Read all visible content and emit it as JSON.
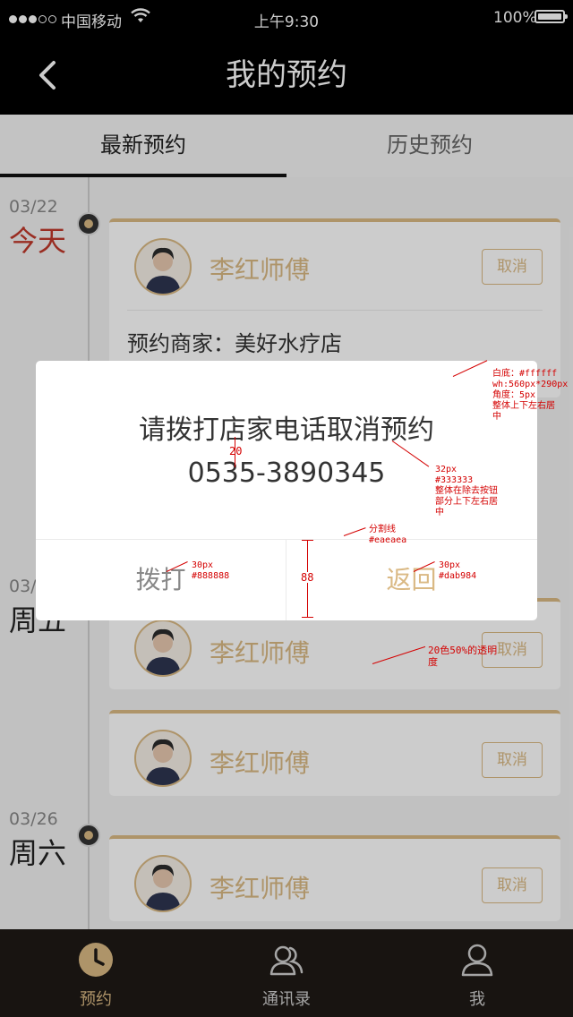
{
  "status_bar": {
    "carrier": "中国移动",
    "time": "上午9:30",
    "battery": "100%"
  },
  "nav": {
    "title": "我的预约",
    "back_icon": "back-arrow-icon"
  },
  "tabs": [
    {
      "label": "最新预约",
      "active": true
    },
    {
      "label": "历史预约",
      "active": false
    }
  ],
  "groups": [
    {
      "date": "03/22",
      "weekday": "今天",
      "today": true
    },
    {
      "date": "03/",
      "weekday": "周五",
      "today": false
    },
    {
      "date": "03/26",
      "weekday": "周六",
      "today": false
    }
  ],
  "cards": [
    {
      "master": "李红师傅",
      "cancel": "取消",
      "merchant_label": "预约商家：",
      "merchant": "美好水疗店"
    },
    {
      "master": "李红师傅",
      "cancel": "取消"
    },
    {
      "master": "李红师傅",
      "cancel": "取消"
    },
    {
      "master": "李红师傅",
      "cancel": "取消"
    }
  ],
  "dialog": {
    "message": "请拨打店家电话取消预约",
    "phone": "0535-3890345",
    "call_label": "拨打",
    "back_label": "返回"
  },
  "annotations": {
    "dialog_spec": "白底：#ffffff\nwh:560px*290px\n角度：5px\n整体上下左右居\n中",
    "text_spec": "32px\n#333333\n整体在除去按钮\n部分上下左右居\n中",
    "divider_spec": "分割线\n#eaeaea",
    "call_spec": "30px\n#888888",
    "back_spec": "30px\n#dab984",
    "mask_spec": "20色50%的透明\n度",
    "gap_value": "20",
    "button_height": "88"
  },
  "tabbar": [
    {
      "label": "预约",
      "icon": "clock-icon",
      "active": true
    },
    {
      "label": "通讯录",
      "icon": "contacts-icon",
      "active": false
    },
    {
      "label": "我",
      "icon": "person-icon",
      "active": false
    }
  ],
  "colors": {
    "accent": "#dab984",
    "mask": "rgba(0,0,0,0.2)",
    "divider": "#eaeaea",
    "call_text": "#888888",
    "text": "#333333"
  }
}
